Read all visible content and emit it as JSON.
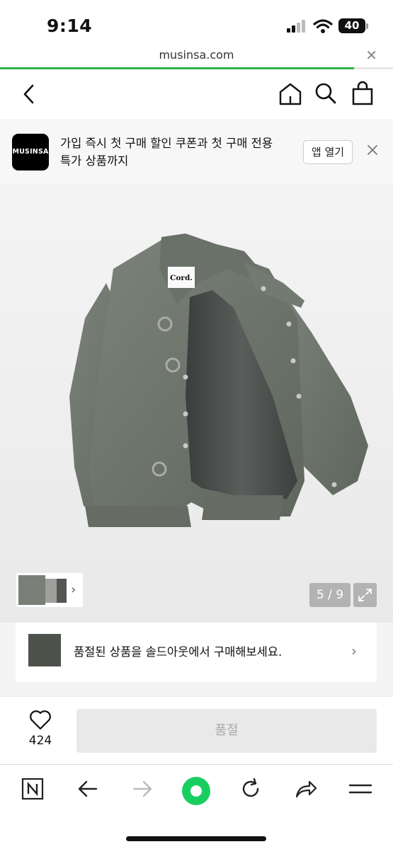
{
  "status_bar": {
    "time": "9:14",
    "battery": "40"
  },
  "browser": {
    "url": "musinsa.com",
    "load_progress": 0.9
  },
  "app_banner": {
    "logo_text": "MUSINSA",
    "message_line1": "가입 즉시 첫 구매 할인 쿠폰과 첫 구매 전용",
    "message_line2": "특가 상품까지",
    "open_label": "앱 열기"
  },
  "gallery": {
    "brand_tag": "Cord.",
    "counter": "5 / 9"
  },
  "soldout_promo": {
    "text": "품절된 상품을 솔드아웃에서 구매해보세요."
  },
  "buy_bar": {
    "likes": "424",
    "button_label": "품절"
  },
  "colors": {
    "accent_green": "#2bb24c",
    "jacket": "#6f766d"
  }
}
